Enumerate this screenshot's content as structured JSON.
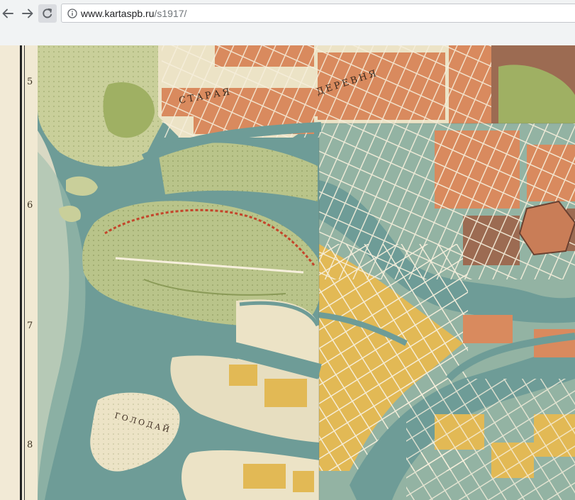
{
  "browser": {
    "url_host": "www.kartaspb.ru",
    "url_path": "/s1917/",
    "icons": {
      "back": "arrow-left-icon",
      "forward": "arrow-right-icon",
      "reload": "reload-icon",
      "info": "info-icon"
    }
  },
  "map": {
    "row_numbers": [
      "5",
      "6",
      "7",
      "8"
    ],
    "labels": {
      "staraya": "СТАРАЯ",
      "derevnya": "ДЕРЕВНЯ",
      "island": "ГОЛОДАЙ"
    },
    "colors": {
      "water": "#6e9c97",
      "land_green": "#b9c48a",
      "land_cream": "#ece3c6",
      "block_orange": "#d98a5e",
      "block_yellow": "#e2b955",
      "block_teal": "#93b3a3",
      "block_brown": "#9c6b52"
    }
  }
}
